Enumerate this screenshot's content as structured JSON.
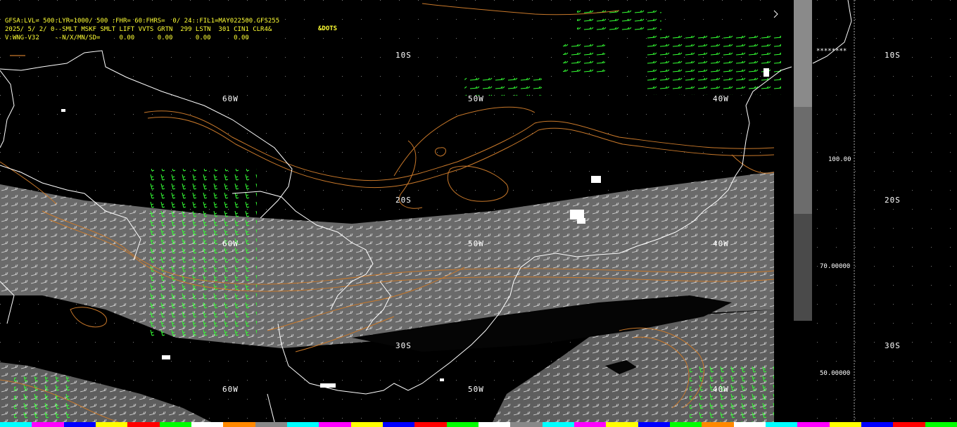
{
  "header": {
    "line1": "GFSA:LVL= 500:LYR=1000/ 500 :FHR= 60:FHRS=  0/ 24::FIL1=MAY022500.GFS255",
    "line2": "2025/ 5/ 2/ 0--SMLT MSKF SMLT LIFT VVTS GRTN  299 LSTN  301 CIN1 CLR4&",
    "line3": "V:WNG-V32    --N/X/MN/SD=     0.00      0.00      0.00      0.00",
    "dots_label": "&DOTS"
  },
  "map": {
    "lat_labels": [
      "10S",
      "20S",
      "30S"
    ],
    "lon_labels": [
      "60W",
      "50W",
      "40W"
    ],
    "right_lat_labels": [
      "10S",
      "20S",
      "30S"
    ],
    "colors": {
      "background": "#000000",
      "coast": "#ffffff",
      "contour": "#c8782a",
      "wind_barb_green": "#33ff33",
      "wind_barb_white": "#d8d8d8",
      "shade_band": "#707070"
    }
  },
  "colorbar": {
    "labels": [
      "100.00",
      "70.00000",
      "50.00000"
    ],
    "star_text": "********",
    "segments": [
      "#000000",
      "#888888",
      "#6c6c6c",
      "#4a4a4a"
    ]
  },
  "palette_strip": [
    "#00ffff",
    "#ff00ff",
    "#0000ff",
    "#ffff00",
    "#ff0000",
    "#00ff00",
    "#ffffff",
    "#ff8800",
    "#888888",
    "#00ffff",
    "#ff00ff",
    "#ffff00",
    "#0000ff",
    "#ff0000",
    "#00ff00",
    "#ffffff",
    "#888888",
    "#00ffff",
    "#ff00ff",
    "#ffff00",
    "#0000ff",
    "#00ff00",
    "#ff8800",
    "#ffffff",
    "#00ffff",
    "#ff00ff",
    "#ffff00",
    "#0000ff",
    "#ff0000",
    "#00ff00"
  ]
}
